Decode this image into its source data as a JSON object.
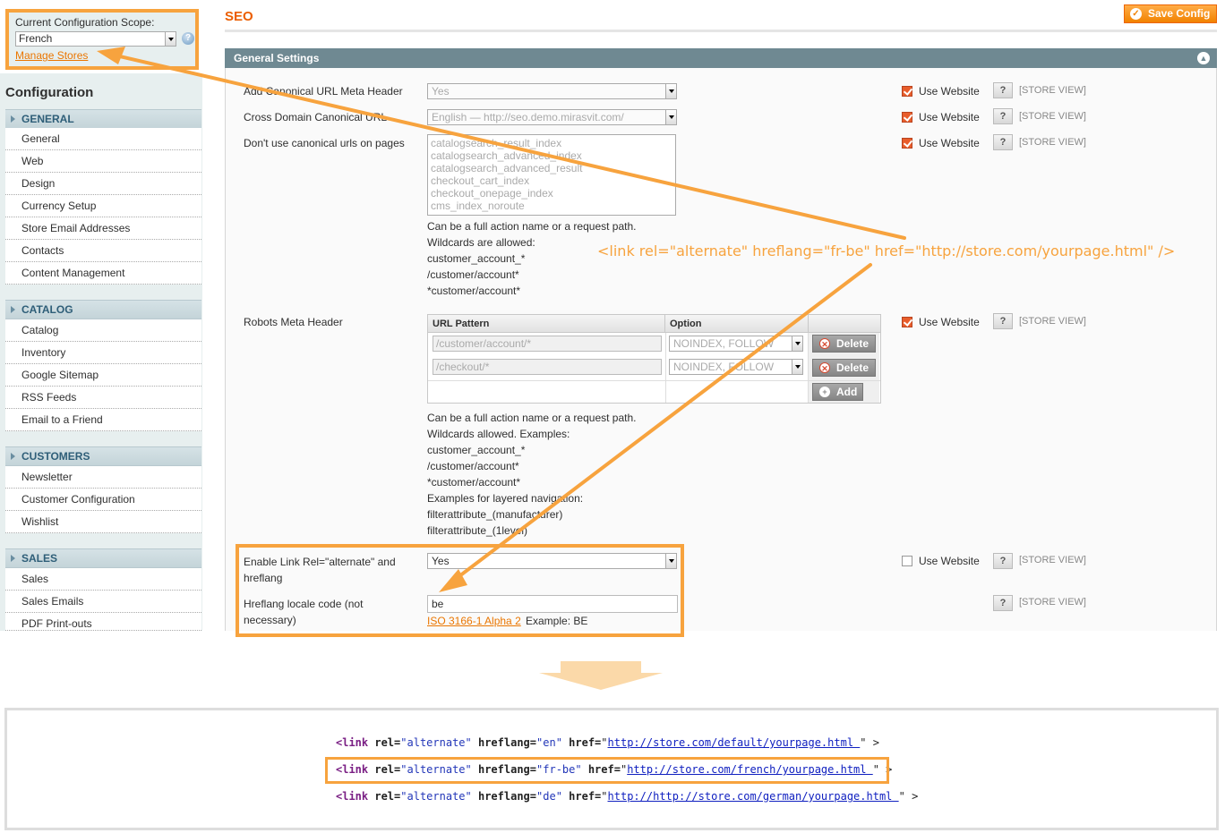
{
  "scope": {
    "label": "Current Configuration Scope:",
    "selected": "French",
    "help": "?",
    "manage_stores": "Manage Stores"
  },
  "sidebar": {
    "title": "Configuration",
    "groups": [
      {
        "label": "GENERAL",
        "items": [
          "General",
          "Web",
          "Design",
          "Currency Setup",
          "Store Email Addresses",
          "Contacts",
          "Content Management"
        ]
      },
      {
        "label": "CATALOG",
        "items": [
          "Catalog",
          "Inventory",
          "Google Sitemap",
          "RSS Feeds",
          "Email to a Friend"
        ]
      },
      {
        "label": "CUSTOMERS",
        "items": [
          "Newsletter",
          "Customer Configuration",
          "Wishlist"
        ]
      },
      {
        "label": "SALES",
        "items": [
          "Sales",
          "Sales Emails",
          "PDF Print-outs"
        ]
      }
    ]
  },
  "page": {
    "title": "SEO",
    "save_button": "Save Config",
    "fieldset_title": "General Settings"
  },
  "fields": {
    "canonical": {
      "label": "Add Canonical URL Meta Header",
      "value": "Yes",
      "use_website": "Use Website",
      "scope": "[STORE VIEW]",
      "help": "?"
    },
    "cross_domain": {
      "label": "Cross Domain Canonical URL",
      "value": "English — http://seo.demo.mirasvit.com/",
      "use_website": "Use Website",
      "scope": "[STORE VIEW]",
      "help": "?"
    },
    "exclude": {
      "label": "Don't use canonical urls on pages",
      "lines": [
        "catalogsearch_result_index",
        "catalogsearch_advanced_index",
        "catalogsearch_advanced_result",
        "checkout_cart_index",
        "checkout_onepage_index",
        "cms_index_noroute"
      ],
      "notes": [
        "Can be a full action name or a request path.",
        "Wildcards are allowed:",
        "customer_account_*",
        "/customer/account*",
        "*customer/account*"
      ],
      "use_website": "Use Website",
      "scope": "[STORE VIEW]",
      "help": "?"
    },
    "robots": {
      "label": "Robots Meta Header",
      "col_pattern": "URL Pattern",
      "col_option": "Option",
      "rows": [
        {
          "pattern": "/customer/account/*",
          "option": "NOINDEX, FOLLOW",
          "delete": "Delete"
        },
        {
          "pattern": "/checkout/*",
          "option": "NOINDEX, FOLLOW",
          "delete": "Delete"
        }
      ],
      "add": "Add",
      "notes": [
        "Can be a full action name or a request path.",
        "Wildcards allowed. Examples:",
        "customer_account_*",
        "/customer/account*",
        "*customer/account*",
        "Examples for layered navigation:",
        "filterattribute_(manufacturer)",
        "filterattribute_(1level)"
      ],
      "use_website": "Use Website",
      "scope": "[STORE VIEW]",
      "help": "?"
    },
    "enable_alternate": {
      "label_line1": "Enable Link Rel=\"alternate\" and",
      "label_line2": "hreflang",
      "value": "Yes",
      "use_website": "Use Website",
      "scope": "[STORE VIEW]",
      "help": "?"
    },
    "hreflang_code": {
      "label_line1": "Hreflang locale code (not",
      "label_line2": "necessary)",
      "value": "be",
      "link": "ISO 3166-1 Alpha 2",
      "example": "Example: BE",
      "scope": "[STORE VIEW]",
      "help": "?"
    }
  },
  "annotation": "<link rel=\"alternate\" hreflang=\"fr-be\" href=\"http://store.com/yourpage.html\" />",
  "code": [
    {
      "hreflang": "\"en\"",
      "url": "http://store.com/default/yourpage.html "
    },
    {
      "hreflang": "\"fr-be\"",
      "url": "http://store.com/french/yourpage.html "
    },
    {
      "hreflang": "\"de\"",
      "url": "http://http://store.com/german/yourpage.html "
    }
  ],
  "code_tokens": {
    "open": "<link",
    "rel": "rel=",
    "rel_val": "\"alternate\"",
    "hreflang": "hreflang=",
    "href": "href=",
    "close": "\" >",
    "quote": "\""
  },
  "colors": {
    "accent_orange": "#f7a33e",
    "title_orange": "#eb5e00",
    "fieldset_header": "#6f8992",
    "sidebar_bg": "#e7efef"
  }
}
